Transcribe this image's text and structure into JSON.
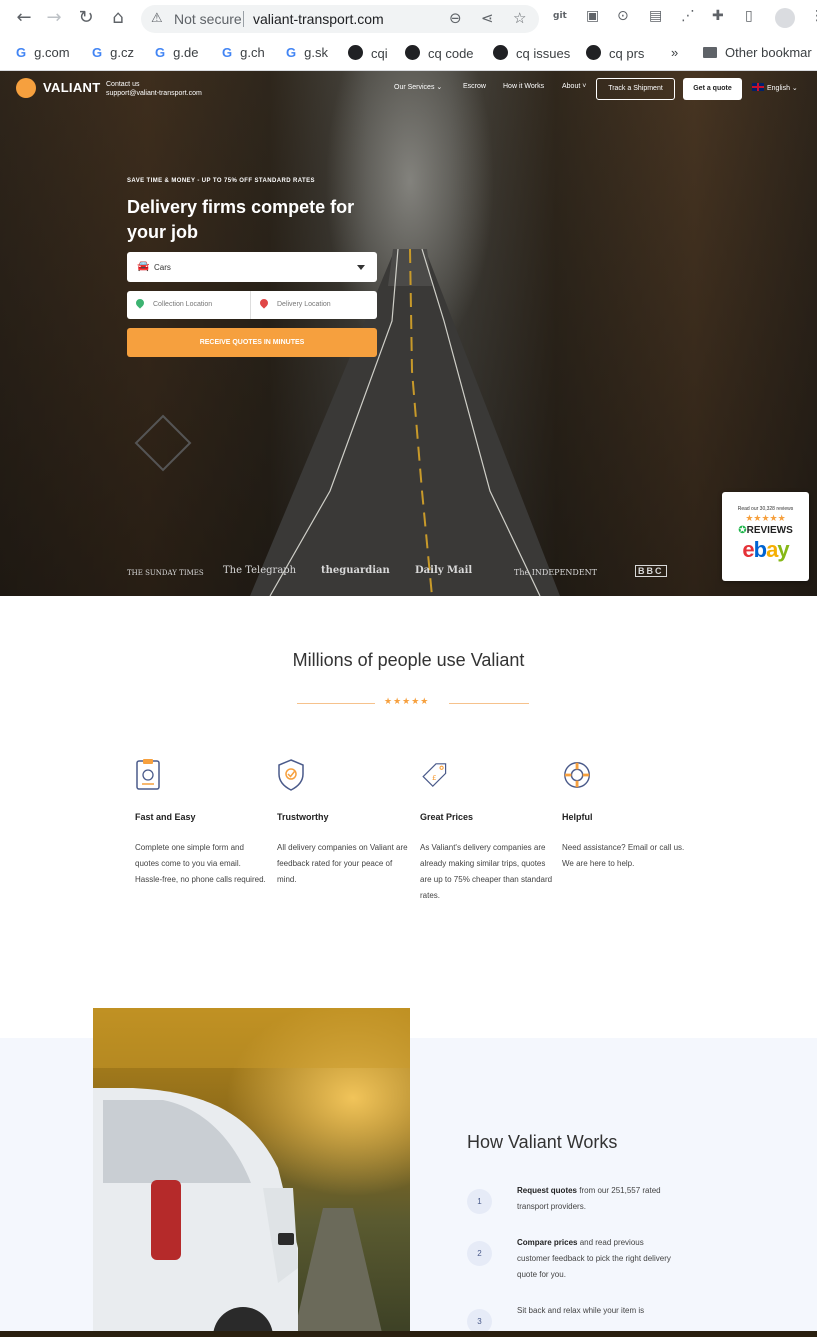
{
  "browser": {
    "security_label": "Not secure",
    "url": "valiant-transport.com",
    "bookmarks": [
      {
        "label": "g.com",
        "type": "google"
      },
      {
        "label": "g.cz",
        "type": "google"
      },
      {
        "label": "g.de",
        "type": "google"
      },
      {
        "label": "g.ch",
        "type": "google"
      },
      {
        "label": "g.sk",
        "type": "google"
      },
      {
        "label": "cqi",
        "type": "github"
      },
      {
        "label": "cq code",
        "type": "github"
      },
      {
        "label": "cq issues",
        "type": "github"
      },
      {
        "label": "cq prs",
        "type": "github"
      }
    ],
    "overflow_label": "»",
    "other_bookmarks": "Other bookmar"
  },
  "site": {
    "brand": "VALIANT",
    "contact_line1": "Contact us",
    "contact_line2": "support@valiant-transport.com",
    "nav": {
      "services": "Our Services",
      "escrow": "Escrow",
      "how": "How it Works",
      "about": "About"
    },
    "track_button": "Track a Shipment",
    "quote_button": "Get a quote",
    "language": "English"
  },
  "hero": {
    "eyebrow": "SAVE TIME & MONEY - UP TO 75% OFF STANDARD RATES",
    "title": "Delivery firms compete for your job",
    "vehicle_select": "Cars",
    "collection_placeholder": "Collection Location",
    "delivery_placeholder": "Delivery Location",
    "cta": "RECEIVE QUOTES IN MINUTES",
    "press": [
      "THE SUNDAY TIMES",
      "The Telegraph",
      "theguardian",
      "Daily Mail",
      "The INDEPENDENT",
      "BBC"
    ]
  },
  "reviews_widget": {
    "line1": "Read our 30,328 reviews",
    "stars": "★★★★★",
    "reviews_label": "REVIEWS",
    "platform": "ebay"
  },
  "social_proof": {
    "heading": "Millions of people use Valiant",
    "stars": "★★★★★"
  },
  "features": [
    {
      "title": "Fast and Easy",
      "text": "Complete one simple form and quotes come to you via email. Hassle-free, no phone calls required."
    },
    {
      "title": "Trustworthy",
      "text": "All delivery companies on Valiant are feedback rated for your peace of mind."
    },
    {
      "title": "Great Prices",
      "text": "As Valiant's delivery companies are already making similar trips, quotes are up to 75% cheaper than standard rates."
    },
    {
      "title": "Helpful",
      "text": "Need assistance? Email or call us. We are here to help."
    }
  ],
  "how": {
    "heading": "How Valiant Works",
    "steps": [
      {
        "num": "1",
        "bold": "Request quotes",
        "rest": " from our 251,557 rated transport providers."
      },
      {
        "num": "2",
        "bold": "Compare prices",
        "rest": " and read previous customer feedback to pick the right delivery quote for you."
      },
      {
        "num": "3",
        "bold": "",
        "rest": "Sit back and relax while your item is"
      }
    ]
  },
  "colors": {
    "accent": "#f6a03e",
    "band": "#f4f7fd"
  }
}
